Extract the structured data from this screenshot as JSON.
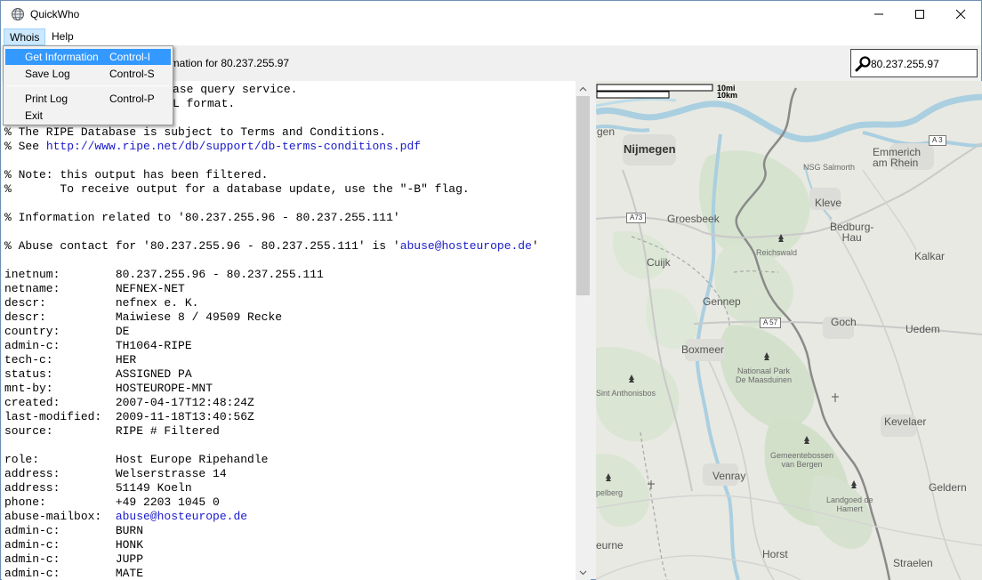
{
  "window": {
    "title": "QuickWho"
  },
  "menubar": {
    "whois": "Whois",
    "help": "Help"
  },
  "dropdown": {
    "items": [
      {
        "label": "Get Information",
        "shortcut": "Control-I"
      },
      {
        "label": "Save Log",
        "shortcut": "Control-S"
      },
      {
        "label": "Print Log",
        "shortcut": "Control-P"
      },
      {
        "label": "Exit",
        "shortcut": ""
      }
    ]
  },
  "toolbar": {
    "info_label": "ormation for 80.237.255.97",
    "search_value": "80.237.255.97"
  },
  "whois_lines": [
    [
      "",
      "ase query service.",
      ""
    ],
    [
      "",
      "L format.",
      ""
    ],
    [
      "",
      "",
      ""
    ],
    [
      "% The RIPE Database is subject to Terms and Conditions.",
      "",
      ""
    ],
    [
      "% See ",
      "http://www.ripe.net/db/support/db-terms-conditions.pdf",
      ""
    ],
    [
      "",
      "",
      ""
    ],
    [
      "% Note: this output has been filtered.",
      "",
      ""
    ],
    [
      "%       To receive output for a database update, use the \"-B\" flag.",
      "",
      ""
    ],
    [
      "",
      "",
      ""
    ],
    [
      "% Information related to '80.237.255.96 - 80.237.255.111'",
      "",
      ""
    ],
    [
      "",
      "",
      ""
    ],
    [
      "% Abuse contact for '80.237.255.96 - 80.237.255.111' is '",
      "abuse@hosteurope.de",
      "'"
    ],
    [
      "",
      "",
      ""
    ],
    [
      "inetnum:        80.237.255.96 - 80.237.255.111",
      "",
      ""
    ],
    [
      "netname:        NEFNEX-NET",
      "",
      ""
    ],
    [
      "descr:          nefnex e. K.",
      "",
      ""
    ],
    [
      "descr:          Maiwiese 8 / 49509 Recke",
      "",
      ""
    ],
    [
      "country:        DE",
      "",
      ""
    ],
    [
      "admin-c:        TH1064-RIPE",
      "",
      ""
    ],
    [
      "tech-c:         HER",
      "",
      ""
    ],
    [
      "status:         ASSIGNED PA",
      "",
      ""
    ],
    [
      "mnt-by:         HOSTEUROPE-MNT",
      "",
      ""
    ],
    [
      "created:        2007-04-17T12:48:24Z",
      "",
      ""
    ],
    [
      "last-modified:  2009-11-18T13:40:56Z",
      "",
      ""
    ],
    [
      "source:         RIPE # Filtered",
      "",
      ""
    ],
    [
      "",
      "",
      ""
    ],
    [
      "role:           Host Europe Ripehandle",
      "",
      ""
    ],
    [
      "address:        Welserstrasse 14",
      "",
      ""
    ],
    [
      "address:        51149 Koeln",
      "",
      ""
    ],
    [
      "phone:          +49 2203 1045 0",
      "",
      ""
    ],
    [
      "abuse-mailbox:  ",
      "abuse@hosteurope.de",
      ""
    ],
    [
      "admin-c:        BURN",
      "",
      ""
    ],
    [
      "admin-c:        HONK",
      "",
      ""
    ],
    [
      "admin-c:        JUPP",
      "",
      ""
    ],
    [
      "admin-c:        MATE",
      "",
      ""
    ]
  ],
  "map": {
    "scale": {
      "mi": "10mi",
      "km": "10km"
    },
    "labels": {
      "gen": "gen",
      "nijmegen": "Nijmegen",
      "emmerich": "Emmerich\nam Rhein",
      "nsg": "NSG Salmorth",
      "groesbeek": "Groesbeek",
      "kleve": "Kleve",
      "bedburg": "Bedburg-\nHau",
      "reichswald": "Reichswald",
      "kalkar": "Kalkar",
      "cuijk": "Cuijk",
      "gennep": "Gennep",
      "goch": "Goch",
      "uedem": "Uedem",
      "boxmeer": "Boxmeer",
      "maasduinen": "Nationaal Park\nDe Maasduinen",
      "anthonis": "Sint Anthonisbos",
      "kevelaer": "Kevelaer",
      "gemeente": "Gemeentebossen\nvan Bergen",
      "venray": "Venray",
      "landgoed": "Landgoed de\nHamert",
      "geldern": "Geldern",
      "opelberg": "pelberg",
      "eurne": "eurne",
      "horst": "Horst",
      "straelen": "Straelen"
    },
    "roads": {
      "a3": "A 3",
      "a73": "A73",
      "a57": "A 57"
    }
  }
}
